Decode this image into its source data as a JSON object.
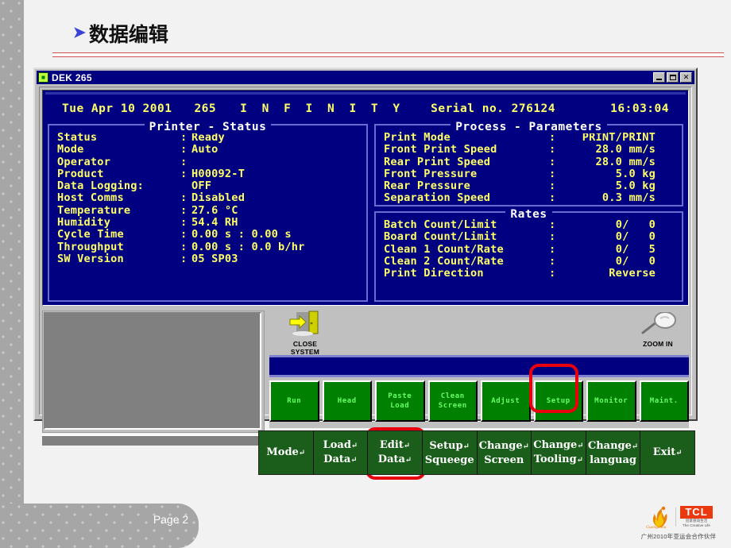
{
  "slide": {
    "heading": "数据编辑",
    "bullet_glyph": "➤",
    "page_label": "Page 2",
    "accent_rule_color": "#d05050"
  },
  "window": {
    "title": "DEK 265",
    "icon": "dek-app-icon",
    "controls": {
      "minimize": "minimize-icon",
      "maximize": "maximize-icon",
      "close": "✕"
    }
  },
  "status_line": {
    "date": "Tue Apr 10 2001",
    "model": "265",
    "brand": "I N F I N I T Y",
    "serial": "Serial no. 276124",
    "time": "16:03:04"
  },
  "printer_status": {
    "title": "Printer - Status",
    "rows": [
      {
        "key": "Status",
        "sep": ":",
        "value": "Ready"
      },
      {
        "key": "Mode",
        "sep": ":",
        "value": "Auto"
      },
      {
        "key": "Operator",
        "sep": ":",
        "value": ""
      },
      {
        "key": "Product",
        "sep": ":",
        "value": "H00092-T"
      },
      {
        "key": "Data Logging:",
        "sep": "",
        "value": "OFF"
      },
      {
        "key": "Host Comms",
        "sep": ":",
        "value": "Disabled"
      },
      {
        "key": "Temperature",
        "sep": ":",
        "value": "27.6 °C"
      },
      {
        "key": "Humidity",
        "sep": ":",
        "value": "54.4 RH"
      },
      {
        "key": "Cycle Time",
        "sep": ":",
        "value": "0.00 s : 0.00 s"
      },
      {
        "key": "Throughput",
        "sep": ":",
        "value": "0.00 s : 0.0 b/hr"
      },
      {
        "key": "SW Version",
        "sep": ":",
        "value": "05 SP03"
      }
    ]
  },
  "process_parameters": {
    "title": "Process - Parameters",
    "rows": [
      {
        "key": "Print Mode",
        "sep": ":",
        "value": "PRINT/PRINT"
      },
      {
        "key": "Front Print Speed",
        "sep": ":",
        "value": "28.0 mm/s"
      },
      {
        "key": "Rear Print Speed",
        "sep": ":",
        "value": "28.0 mm/s"
      },
      {
        "key": "Front Pressure",
        "sep": ":",
        "value": "5.0 kg"
      },
      {
        "key": "Rear Pressure",
        "sep": ":",
        "value": "5.0 kg"
      },
      {
        "key": "Separation Speed",
        "sep": ":",
        "value": "0.3 mm/s"
      }
    ]
  },
  "rates": {
    "title": "Rates",
    "rows": [
      {
        "key": "Batch Count/Limit",
        "sep": ":",
        "value": "0/   0"
      },
      {
        "key": "Board Count/Limit",
        "sep": ":",
        "value": "0/   0"
      },
      {
        "key": "Clean 1 Count/Rate",
        "sep": ":",
        "value": "0/   5"
      },
      {
        "key": "Clean 2 Count/Rate",
        "sep": ":",
        "value": "0/   0"
      },
      {
        "key": "Print Direction",
        "sep": ":",
        "value": "Reverse"
      }
    ]
  },
  "tool_icons": [
    {
      "name": "close-system-icon",
      "line1": "CLOSE",
      "line2": "SYSTEM"
    },
    {
      "name": "zoom-in-icon",
      "line1": "ZOOM IN",
      "line2": ""
    }
  ],
  "function_buttons": [
    {
      "line1": "Run",
      "line2": ""
    },
    {
      "line1": "Head",
      "line2": ""
    },
    {
      "line1": "Paste",
      "line2": "Load"
    },
    {
      "line1": "Clean",
      "line2": "Screen"
    },
    {
      "line1": "Adjust",
      "line2": ""
    },
    {
      "line1": "Setup",
      "line2": ""
    },
    {
      "line1": "Monitor",
      "line2": ""
    },
    {
      "line1": "Maint.",
      "line2": ""
    }
  ],
  "menu_buttons": [
    {
      "line1": "Mode",
      "line2": "",
      "mark1": "↵",
      "mark2": ""
    },
    {
      "line1": "Load",
      "line2": "Data",
      "mark1": "↵",
      "mark2": "↵"
    },
    {
      "line1": "Edit",
      "line2": "Data",
      "mark1": "↵",
      "mark2": "↵"
    },
    {
      "line1": "Setup",
      "line2": "Squeege",
      "mark1": "↵",
      "mark2": ""
    },
    {
      "line1": "Change",
      "line2": "Screen",
      "mark1": "↵",
      "mark2": ""
    },
    {
      "line1": "Change",
      "line2": "Tooling",
      "mark1": "↵",
      "mark2": "↵"
    },
    {
      "line1": "Change",
      "line2": "languag",
      "mark1": "↵",
      "mark2": ""
    },
    {
      "line1": "Exit",
      "line2": "",
      "mark1": "↵",
      "mark2": ""
    }
  ],
  "highlights": {
    "setup_button": "Setup",
    "edit_data_button": "Edit Data",
    "color": "#e8000d"
  },
  "logo": {
    "brand": "TCL",
    "tagline_cn": "创意感动生活",
    "tagline_en": "The Creative Life",
    "partner_text": "广州2010年亚运会合作伙伴",
    "mascot_word": "Guangzhou"
  }
}
